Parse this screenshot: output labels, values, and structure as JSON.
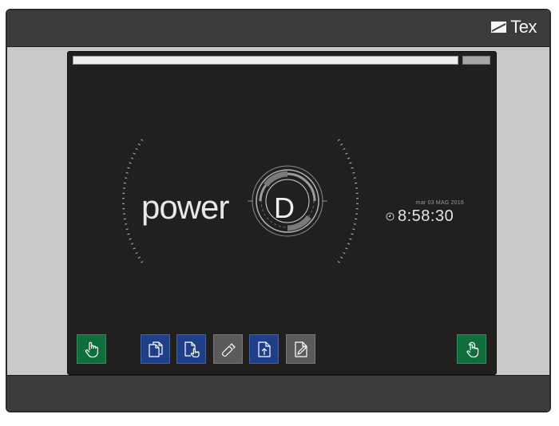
{
  "brand": {
    "name": "Tex",
    "logo_icon": "brand-slash-icon"
  },
  "status": {
    "date": "mar 03 MAG 2016",
    "time": "8:58:30",
    "clock_icon": "clock-icon"
  },
  "splash": {
    "word": "power",
    "letter": "D"
  },
  "progress": {
    "fraction": 0.0
  },
  "toolbar": {
    "left_button": {
      "icon": "hand-pointer-icon",
      "color": "#0e6e3c"
    },
    "right_button": {
      "icon": "touch-tap-icon",
      "color": "#0e6e3c"
    },
    "tools": [
      {
        "icon": "copy-documents-icon",
        "color": "#1f3f88"
      },
      {
        "icon": "document-touch-icon",
        "color": "#1f3f88"
      },
      {
        "icon": "usb-drive-icon",
        "color": "#5b5b5b"
      },
      {
        "icon": "document-upload-icon",
        "color": "#1f3f88"
      },
      {
        "icon": "document-edit-icon",
        "color": "#5b5b5b"
      }
    ]
  }
}
